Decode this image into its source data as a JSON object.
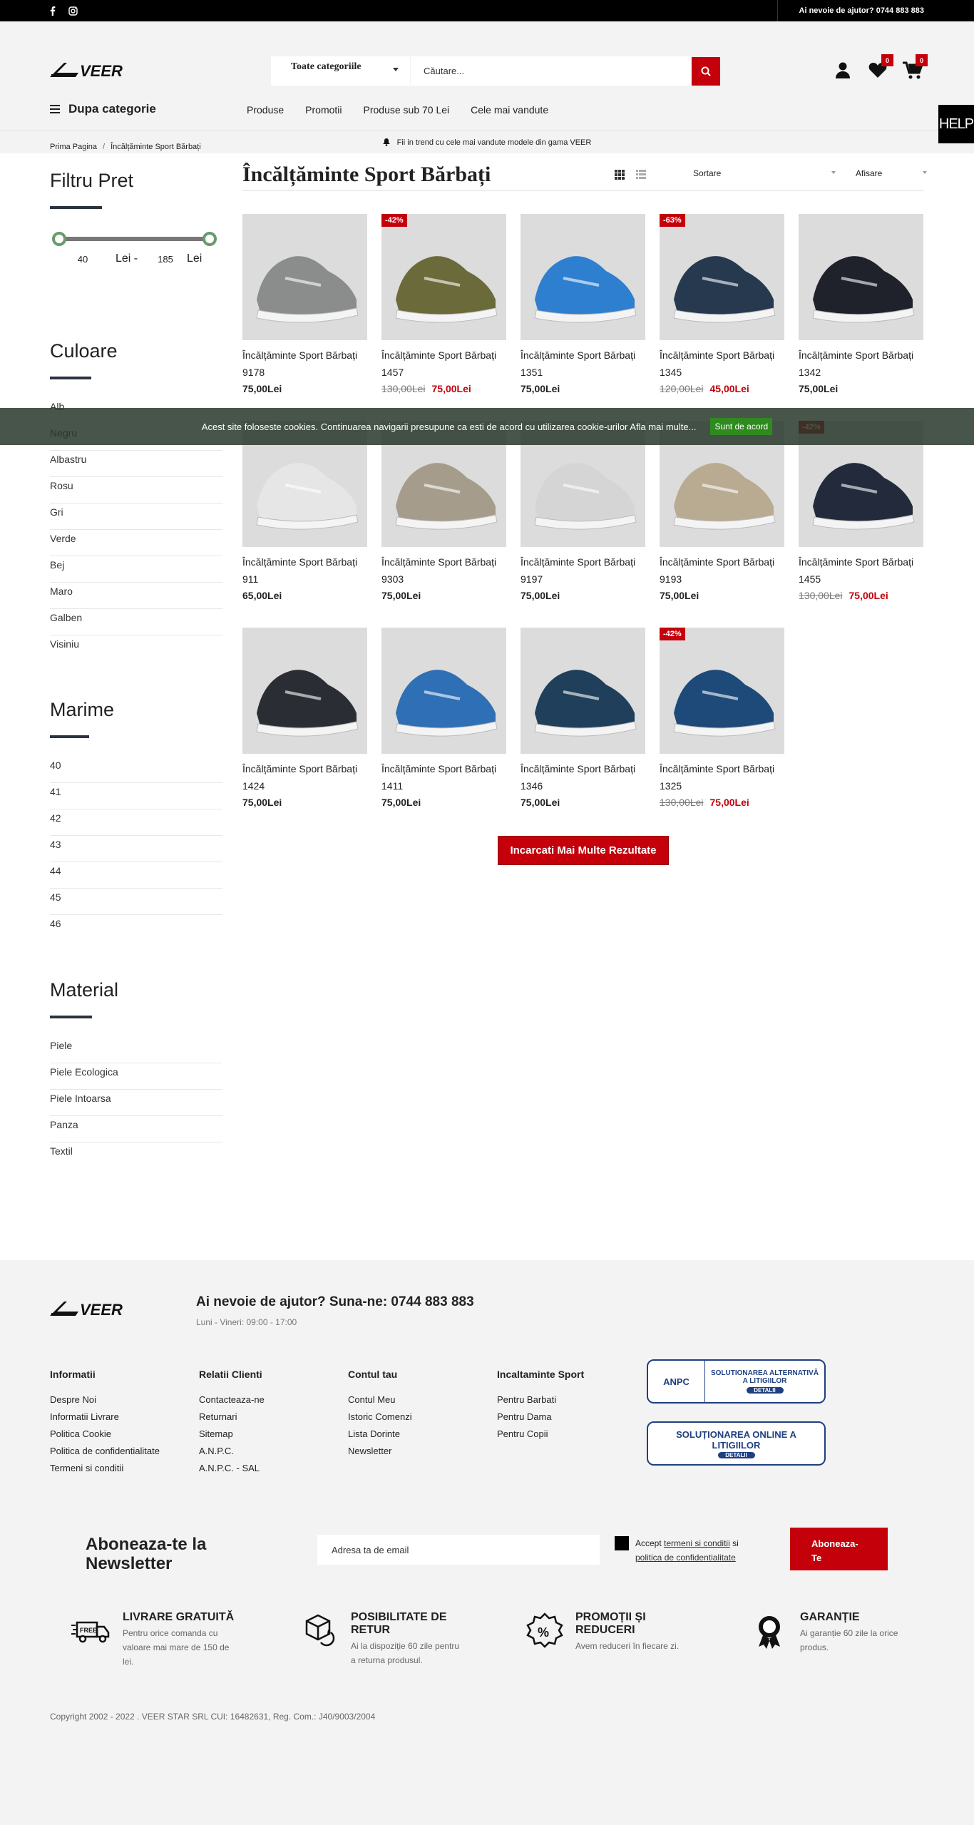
{
  "topbar": {
    "help": "Ai nevoie de ajutor? 0744 883 883"
  },
  "header": {
    "category_select": "Toate categoriile",
    "search_placeholder": "Căutare...",
    "wishlist_count": "0",
    "cart_count": "0",
    "category_menu": "Dupa categorie",
    "nav": [
      "Produse",
      "Promotii",
      "Produse sub 70 Lei",
      "Cele mai vandute"
    ],
    "trend": "Fii in trend cu cele mai vandute modele din gama VEER",
    "help_button": "HELP"
  },
  "breadcrumb": {
    "home": "Prima Pagina",
    "sep": "/",
    "current": "Încălțăminte Sport Bărbați"
  },
  "filters": {
    "price_title": "Filtru Pret",
    "price_min": "40",
    "price_max": "185",
    "currency": "Lei",
    "price_sep": "Lei -",
    "color_title": "Culoare",
    "colors": [
      "Alb",
      "Negru",
      "Albastru",
      "Rosu",
      "Gri",
      "Verde",
      "Bej",
      "Maro",
      "Galben",
      "Visiniu"
    ],
    "size_title": "Marime",
    "sizes": [
      "40",
      "41",
      "42",
      "43",
      "44",
      "45",
      "46"
    ],
    "material_title": "Material",
    "materials": [
      "Piele",
      "Piele Ecologica",
      "Piele Intoarsa",
      "Panza",
      "Textil"
    ]
  },
  "main": {
    "title": "Încălțăminte Sport Bărbați",
    "sort_label": "Sortare",
    "display_label": "Afisare",
    "load_more": "Incarcati Mai Multe Rezultate",
    "products": [
      {
        "name": "Încălțăminte Sport Bărbați",
        "code": "9178",
        "price": "75,00Lei",
        "old": "",
        "discount": "",
        "color": "#8b8d8c"
      },
      {
        "name": "Încălțăminte Sport Bărbați",
        "code": "1457",
        "price": "75,00Lei",
        "old": "130,00Lei",
        "discount": "-42%",
        "color": "#6b6a3a"
      },
      {
        "name": "Încălțăminte Sport Bărbați",
        "code": "1351",
        "price": "75,00Lei",
        "old": "",
        "discount": "",
        "color": "#2f7fd0"
      },
      {
        "name": "Încălțăminte Sport Bărbați",
        "code": "1345",
        "price": "45,00Lei",
        "old": "120,00Lei",
        "discount": "-63%",
        "color": "#27394f"
      },
      {
        "name": "Încălțăminte Sport Bărbați",
        "code": "1342",
        "price": "75,00Lei",
        "old": "",
        "discount": "",
        "color": "#1f222b"
      },
      {
        "name": "Încălțăminte Sport Bărbați",
        "code": "911",
        "price": "65,00Lei",
        "old": "",
        "discount": "",
        "color": "#e6e6e6"
      },
      {
        "name": "Încălțăminte Sport Bărbați",
        "code": "9303",
        "price": "75,00Lei",
        "old": "",
        "discount": "",
        "color": "#a59c8c"
      },
      {
        "name": "Încălțăminte Sport Bărbați",
        "code": "9197",
        "price": "75,00Lei",
        "old": "",
        "discount": "",
        "color": "#d5d5d5"
      },
      {
        "name": "Încălțăminte Sport Bărbați",
        "code": "9193",
        "price": "75,00Lei",
        "old": "",
        "discount": "",
        "color": "#b8ab92"
      },
      {
        "name": "Încălțăminte Sport Bărbați",
        "code": "1455",
        "price": "75,00Lei",
        "old": "130,00Lei",
        "discount": "-42%",
        "color": "#222a3c"
      },
      {
        "name": "Încălțăminte Sport Bărbați",
        "code": "1424",
        "price": "75,00Lei",
        "old": "",
        "discount": "",
        "color": "#2a2d34"
      },
      {
        "name": "Încălțăminte Sport Bărbați",
        "code": "1411",
        "price": "75,00Lei",
        "old": "",
        "discount": "",
        "color": "#2f6fb5"
      },
      {
        "name": "Încălțăminte Sport Bărbați",
        "code": "1346",
        "price": "75,00Lei",
        "old": "",
        "discount": "",
        "color": "#1f3f5a"
      },
      {
        "name": "Încălțăminte Sport Bărbați",
        "code": "1325",
        "price": "75,00Lei",
        "old": "130,00Lei",
        "discount": "-42%",
        "color": "#1d4a78"
      }
    ]
  },
  "cookie": {
    "text": "Acest site foloseste cookies. Continuarea navigarii presupune ca esti de acord cu utilizarea cookie-urilor Afla mai multe...",
    "accept": "Sunt de acord"
  },
  "footer": {
    "help": "Ai nevoie de ajutor? Suna-ne: 0744 883 883",
    "hours": "Luni - Vineri: 09:00 - 17:00",
    "cols": [
      {
        "title": "Informatii",
        "links": [
          "Despre Noi",
          "Informatii Livrare",
          "Politica Cookie",
          "Politica de confidentialitate",
          "Termeni si conditii"
        ]
      },
      {
        "title": "Relatii Clienti",
        "links": [
          "Contacteaza-ne",
          "Returnari",
          "Sitemap",
          "A.N.P.C.",
          "A.N.P.C. - SAL"
        ]
      },
      {
        "title": "Contul tau",
        "links": [
          "Contul Meu",
          "Istoric Comenzi",
          "Lista Dorinte",
          "Newsletter"
        ]
      },
      {
        "title": "Incaltaminte Sport",
        "links": [
          "Pentru Barbati",
          "Pentru Dama",
          "Pentru Copii"
        ]
      }
    ],
    "anpc1": "SOLUTIONAREA ALTERNATIVĂ A LITIGIILOR",
    "anpc1_logo": "ANPC",
    "anpc2": "SOLUȚIONAREA ONLINE A LITIGIILOR",
    "anpc_details": "DETALII",
    "newsletter_title": "Aboneaza-te la Newsletter",
    "newsletter_placeholder": "Adresa ta de email",
    "accept_pre": "Accept",
    "accept_terms": "termeni si conditii",
    "accept_and": "si",
    "accept_policy": "politica de confidentialitate",
    "subscribe": "Aboneaza-Te",
    "features": [
      {
        "title": "LIVRARE GRATUITĂ",
        "text": "Pentru orice comanda cu valoare mai mare de 150 de lei."
      },
      {
        "title": "POSIBILITATE DE RETUR",
        "text": "Ai la dispoziție 60 zile pentru a returna produsul."
      },
      {
        "title": "PROMOȚII ȘI REDUCERI",
        "text": "Avem reduceri în fiecare zi."
      },
      {
        "title": "GARANȚIE",
        "text": "Ai garanție 60 zile la orice produs."
      }
    ],
    "copyright": "Copyright 2002 - 2022 . VEER STAR SRL CUI: 16482631, Reg. Com.: J40/9003/2004"
  }
}
